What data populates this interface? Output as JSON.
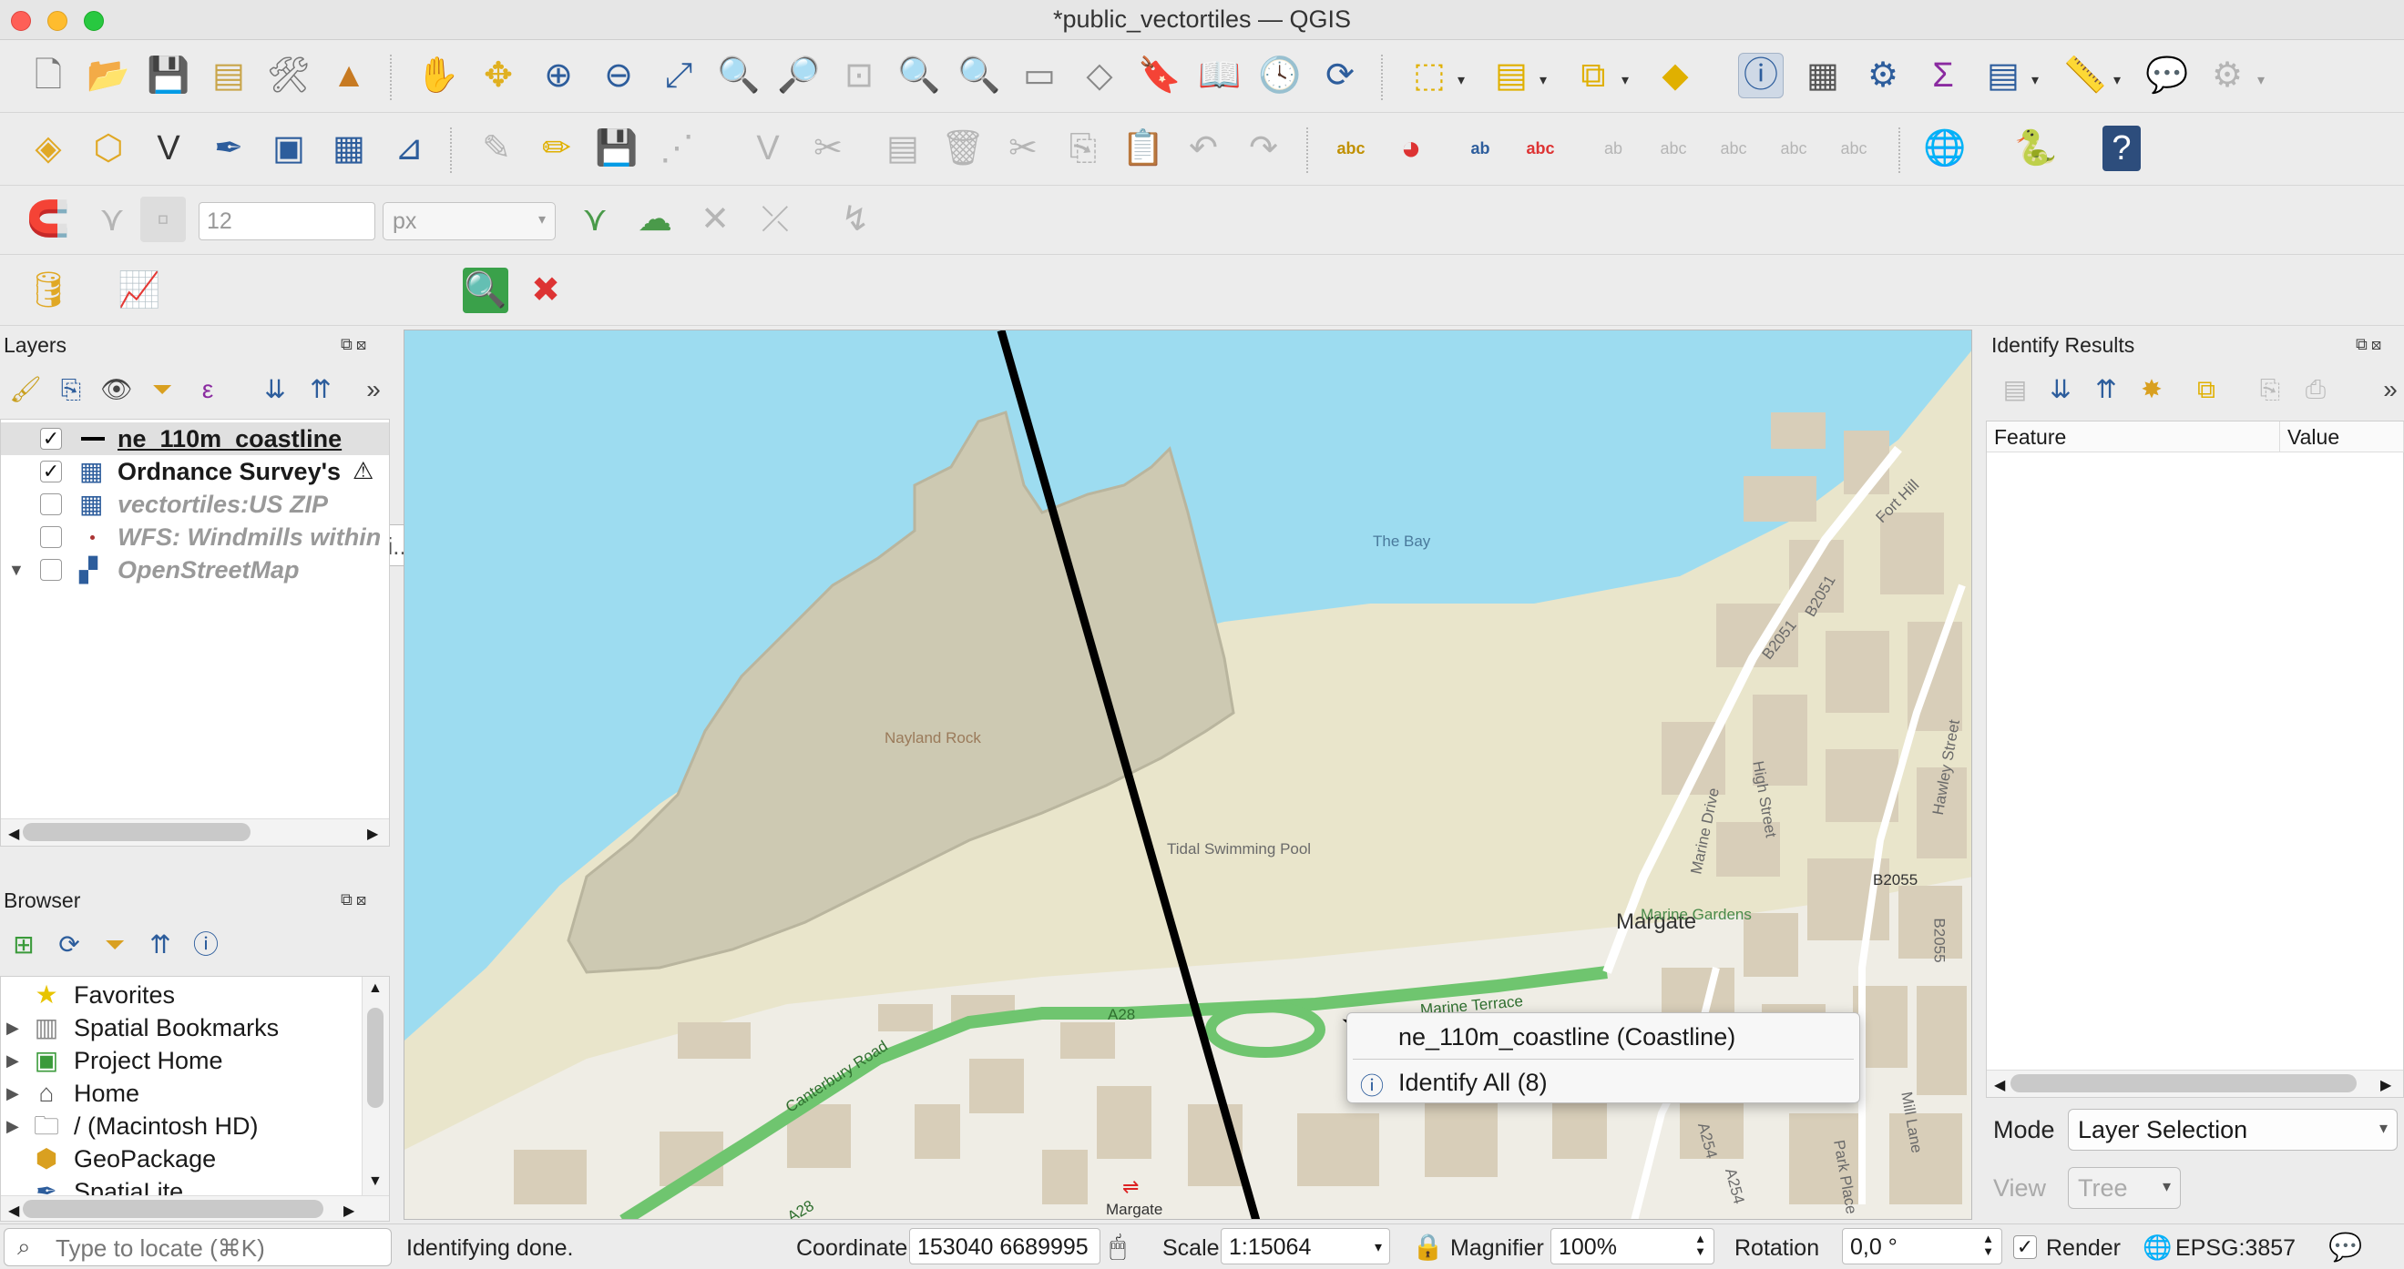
{
  "window": {
    "title": "*public_vectortiles — QGIS"
  },
  "snapping": {
    "tolerance": "12",
    "units": "px"
  },
  "locator_toolbar": {
    "geocoder_placeholder": "MapTiler Geocodi..."
  },
  "layers_panel": {
    "title": "Layers",
    "items": [
      {
        "label": "ne_110m_coastline",
        "checked": true,
        "symbol": "line-symbol"
      },
      {
        "label": "Ordnance Survey's",
        "checked": true,
        "symbol": "raster-grid-icon"
      },
      {
        "label": "vectortiles:US ZIP",
        "checked": false,
        "symbol": "raster-grid-icon"
      },
      {
        "label": "WFS: Windmills within",
        "checked": false,
        "symbol": "point-symbol"
      },
      {
        "label": "OpenStreetMap",
        "checked": false,
        "symbol": "tile-icon"
      }
    ]
  },
  "browser_panel": {
    "title": "Browser",
    "items": [
      {
        "label": "Favorites",
        "icon": "star-icon"
      },
      {
        "label": "Spatial Bookmarks",
        "icon": "bookmark-icon"
      },
      {
        "label": "Project Home",
        "icon": "project-home-icon"
      },
      {
        "label": "Home",
        "icon": "home-icon"
      },
      {
        "label": "/ (Macintosh HD)",
        "icon": "folder-icon"
      },
      {
        "label": "GeoPackage",
        "icon": "geopackage-icon"
      },
      {
        "label": "SpatiaLite",
        "icon": "spatialite-icon"
      }
    ]
  },
  "map": {
    "labels": {
      "the_bay": "The Bay",
      "nayland_rock": "Nayland Rock",
      "tidal_pool": "Tidal Swimming Pool",
      "margate": "Margate",
      "marine_gardens": "Marine Gardens",
      "marine_terrace": "Marine Terrace",
      "a28": "A28",
      "a28_lower": "A28",
      "canterbury_road": "Canterbury Road",
      "b2051": "B2051",
      "b2051b": "B2051",
      "b2055": "B2055",
      "b2055b": "B2055",
      "fort_hill": "Fort Hill",
      "high_street": "High Street",
      "marine_drive": "Marine Drive",
      "hawley_street": "Hawley Street",
      "a254": "A254",
      "a254b": "A254",
      "mill_lane": "Mill Lane",
      "park_place": "Park Place",
      "margate_station": "Margate"
    }
  },
  "context_menu": {
    "items": [
      {
        "label": "ne_110m_coastline (Coastline)"
      },
      {
        "label": "Identify All (8)"
      }
    ]
  },
  "identify_panel": {
    "title": "Identify Results",
    "columns": [
      "Feature",
      "Value"
    ],
    "mode_label": "Mode",
    "mode_value": "Layer Selection",
    "view_label": "View",
    "view_value": "Tree"
  },
  "statusbar": {
    "locator_placeholder": "Type to locate (⌘K)",
    "message": "Identifying done.",
    "coordinate_label": "Coordinate",
    "coordinate_value": "153040 6689995",
    "scale_label": "Scale",
    "scale_value": "1:15064",
    "magnifier_label": "Magnifier",
    "magnifier_value": "100%",
    "rotation_label": "Rotation",
    "rotation_value": "0,0 °",
    "render_label": "Render",
    "render_checked": true,
    "crs": "EPSG:3857"
  },
  "colors": {
    "water": "#9ddcf0",
    "land": "#e9e5cb",
    "rock": "#cdc9b2",
    "road_green": "#6fc56f",
    "building": "#d8ceb9",
    "coastline": "#000000",
    "active_tool": "#cfd9e6"
  }
}
